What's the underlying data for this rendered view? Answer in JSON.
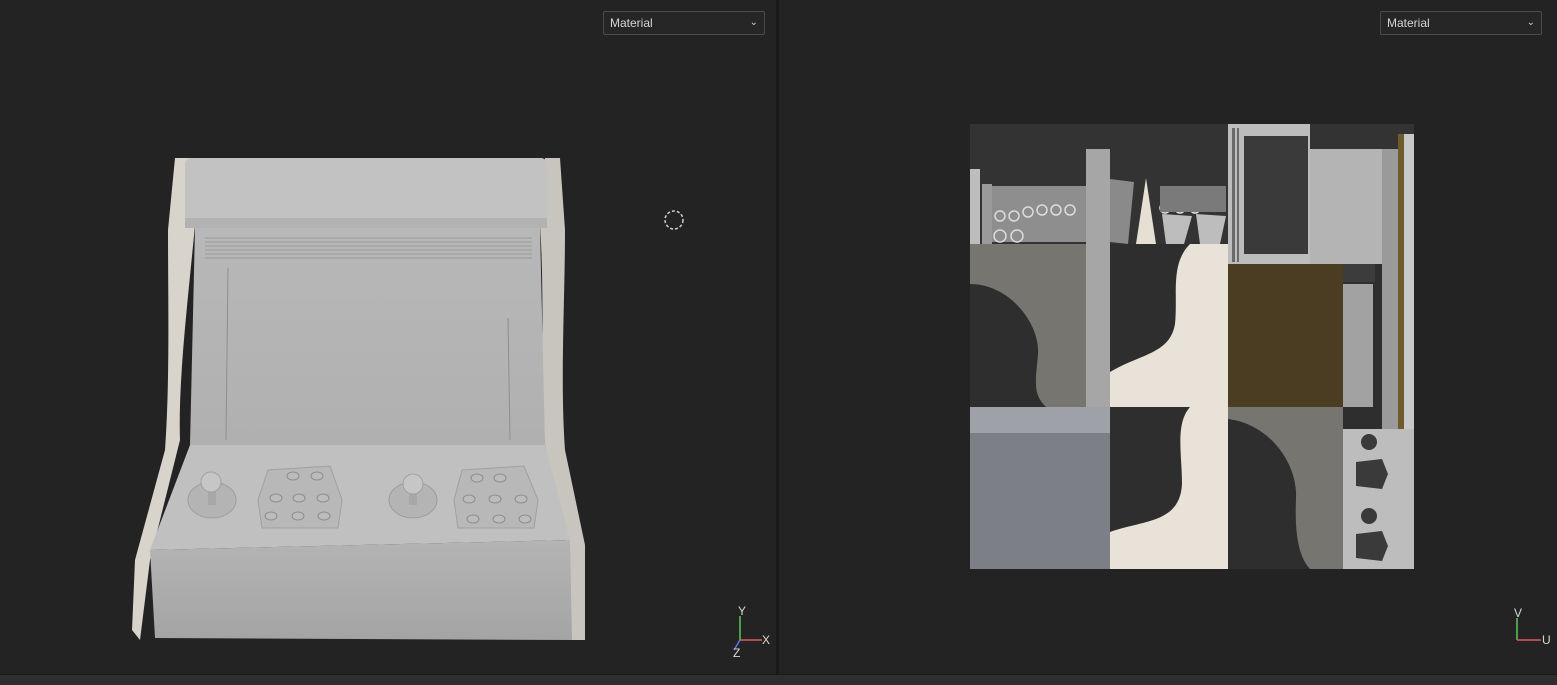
{
  "left_viewport": {
    "shading_mode": "Material",
    "axis": {
      "up": "Y",
      "right": "X",
      "depth": "Z"
    }
  },
  "right_viewport": {
    "shading_mode": "Material",
    "axis": {
      "up": "V",
      "right": "U"
    }
  },
  "colors": {
    "viewport_bg": "#232323",
    "model": "#bdbdbd",
    "axis_x": "#e05a5a",
    "axis_y": "#5ac85a",
    "axis_z": "#5a7ae0"
  },
  "icons": {
    "pivot": "pivot-circle-icon",
    "dropdown": "chevron-down-icon"
  }
}
